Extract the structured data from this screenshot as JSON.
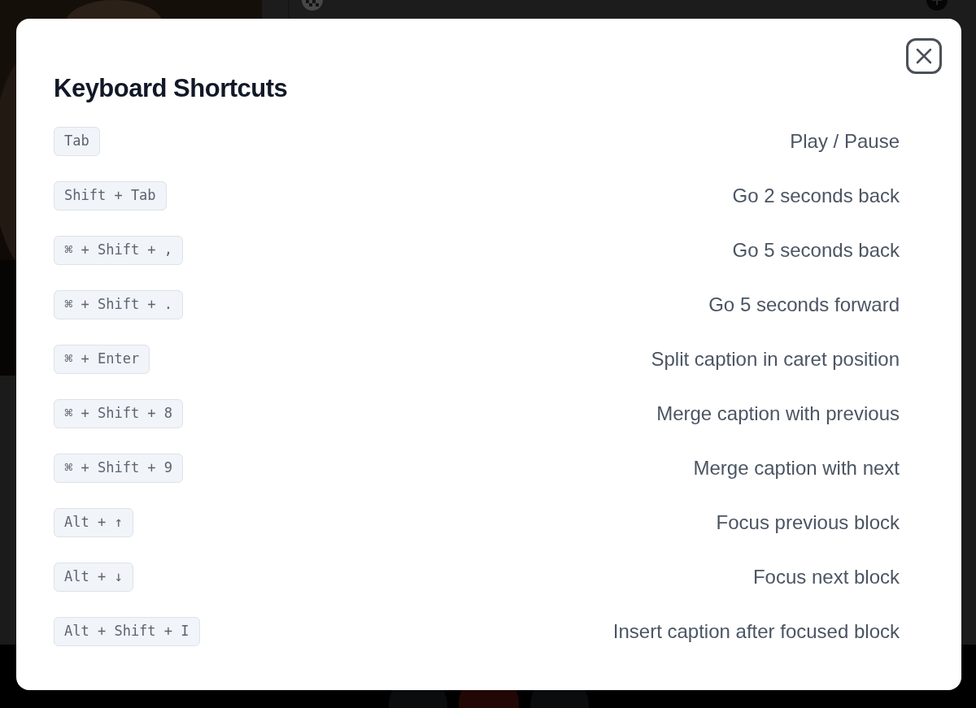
{
  "dialog": {
    "title": "Keyboard Shortcuts",
    "shortcuts": [
      {
        "keys": "Tab",
        "action": "Play / Pause"
      },
      {
        "keys": "Shift + Tab",
        "action": "Go 2 seconds back"
      },
      {
        "keys": "⌘ + Shift + ,",
        "action": "Go 5 seconds back"
      },
      {
        "keys": "⌘ + Shift + .",
        "action": "Go 5 seconds forward"
      },
      {
        "keys": "⌘ + Enter",
        "action": "Split caption in caret position"
      },
      {
        "keys": "⌘ + Shift + 8",
        "action": "Merge caption with previous"
      },
      {
        "keys": "⌘ + Shift + 9",
        "action": "Merge caption with next"
      },
      {
        "keys": "Alt + ↑",
        "action": "Focus previous block"
      },
      {
        "keys": "Alt + ↓",
        "action": "Focus next block"
      },
      {
        "keys": "Alt + Shift + I",
        "action": "Insert caption after focused block"
      }
    ]
  }
}
